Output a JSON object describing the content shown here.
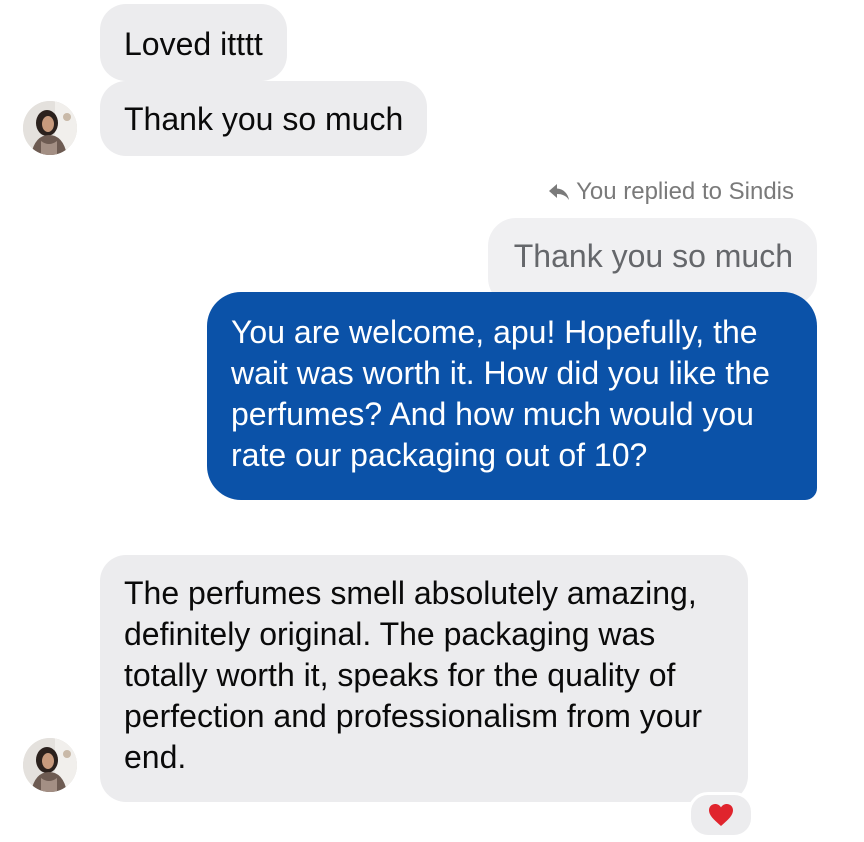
{
  "conversation": {
    "messages": [
      {
        "sender": "Sindis",
        "text": "Loved itttt"
      },
      {
        "sender": "Sindis",
        "text": "Thank you so much"
      },
      {
        "sender": "You",
        "text": "You are welcome, apu! Hopefully, the wait was worth it. How did you like the perfumes? And how much would you rate our packaging out of 10?"
      },
      {
        "sender": "Sindis",
        "text": "The perfumes smell absolutely amazing, definitely original. The packaging was totally worth it, speaks for the quality of perfection and professionalism from your end."
      }
    ],
    "reply_context": {
      "label": "You replied to Sindis",
      "quoted_text": "Thank you so much"
    },
    "reaction": {
      "emoji": "heart",
      "color": "#e0242d"
    }
  },
  "colors": {
    "outgoing_bubble": "#0b52a8",
    "incoming_bubble": "#ececee",
    "quoted_bubble": "#f0f0f2"
  },
  "icons": {
    "reply": "reply-arrow-icon",
    "avatar": "user-avatar-photo",
    "reaction": "heart-icon"
  }
}
